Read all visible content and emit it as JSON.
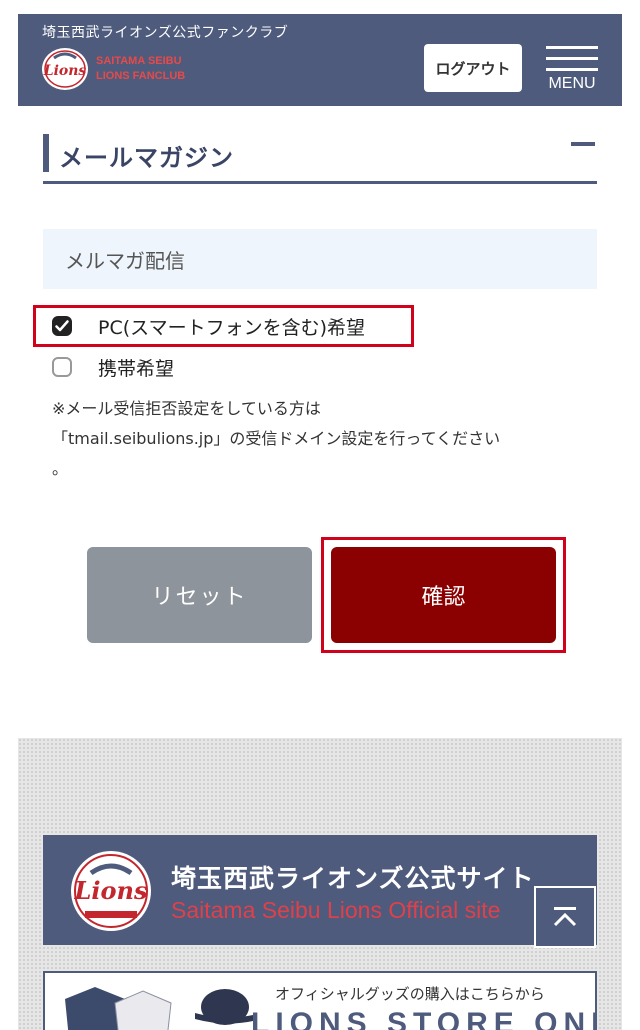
{
  "header": {
    "subtitle": "埼玉西武ライオンズ公式ファンクラブ",
    "logo_text_line1": "SAITAMA SEIBU",
    "logo_text_line2": "LIONS FANCLUB",
    "logo_word": "Lions",
    "logout_label": "ログアウト",
    "menu_label": "MENU"
  },
  "section": {
    "title": "メールマガジン",
    "subheading": "メルマガ配信",
    "options": [
      {
        "label": "PC(スマートフォンを含む)希望",
        "checked": true
      },
      {
        "label": "携帯希望",
        "checked": false
      }
    ],
    "note_line1": "※メール受信拒否設定をしている方は",
    "note_line2": "「tmail.seibulions.jp」の受信ドメイン設定を行ってください",
    "note_line3": "。"
  },
  "buttons": {
    "reset_label": "リセット",
    "confirm_label": "確認"
  },
  "footer": {
    "official_title": "埼玉西武ライオンズ公式サイト",
    "official_en": "Saitama Seibu Lions Official site",
    "store_caption": "オフィシャルグッズの購入はこちらから",
    "store_name": "LIONS STORE ONLINE"
  },
  "colors": {
    "header_navy": "#4e5b7c",
    "confirm_red": "#8b0000",
    "reset_gray": "#8e949b",
    "highlight_red": "#d0021b"
  }
}
